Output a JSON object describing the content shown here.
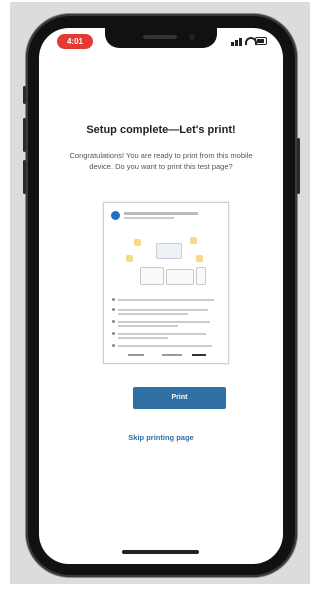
{
  "status_bar": {
    "time_badge": "4:01",
    "badge_color": "#e53935",
    "icons": [
      "signal-icon",
      "wifi-icon",
      "battery-icon"
    ]
  },
  "setup": {
    "title": "Setup complete—Let's print!",
    "message": "Congratulations! You are ready to print from this mobile device. Do you want to print this test page?"
  },
  "test_page": {
    "logo": "hp-logo"
  },
  "actions": {
    "print_label": "Print",
    "skip_label": "Skip printing page"
  },
  "colors": {
    "accent": "#2f6fa3",
    "hp_blue": "#1e70c1"
  }
}
